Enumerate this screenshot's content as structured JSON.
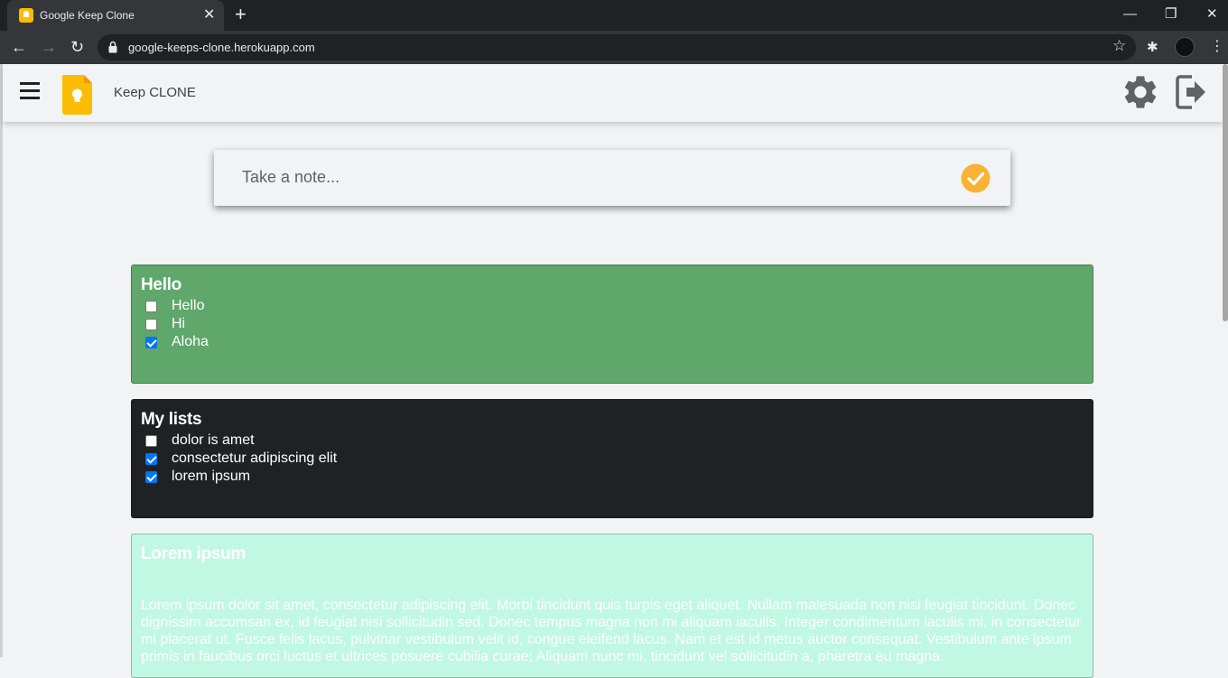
{
  "browser": {
    "tab_title": "Google Keep Clone",
    "tab_close": "✕",
    "new_tab": "+",
    "url": "google-keeps-clone.herokuapp.com",
    "minimize": "—",
    "maximize": "❐",
    "close": "✕",
    "back": "←",
    "forward": "→",
    "reload": "↻",
    "star": "☆",
    "extensions": "✱",
    "menu": "⋮"
  },
  "app": {
    "title": "Keep CLONE",
    "note_placeholder": "Take a note...",
    "colors": {
      "logo": "#fbbc04",
      "check": "#f9b233",
      "icon": "#5f6368"
    }
  },
  "notes": [
    {
      "title": "Hello",
      "bg": "#60a76c",
      "color": "#ffffff",
      "items": [
        {
          "text": "Hello",
          "checked": false
        },
        {
          "text": "Hi",
          "checked": false
        },
        {
          "text": "Aloha",
          "checked": true
        }
      ]
    },
    {
      "title": "My lists",
      "bg": "#202124",
      "color": "#ffffff",
      "items": [
        {
          "text": "dolor is amet",
          "checked": false
        },
        {
          "text": "consectetur adipiscing elit",
          "checked": true
        },
        {
          "text": "lorem ipsum",
          "checked": true
        }
      ]
    },
    {
      "title": "Lorem ipsum",
      "bg": "#c0f8e3",
      "color": "#ffffff",
      "body": "Lorem ipsum dolor sit amet, consectetur adipiscing elit. Morbi tincidunt quis turpis eget aliquet. Nullam malesuada non nisi feugiat tincidunt. Donec dignissim accumsan ex, id feugiat nisi sollicitudin sed. Donec tempus magna non mi aliquam iaculis. Integer condimentum iaculis mi, in consectetur mi placerat ut. Fusce felis lacus, pulvinar vestibulum velit id, congue eleifend lacus. Nam et est id metus auctor consequat. Vestibulum ante ipsum primis in faucibus orci luctus et ultrices posuere cubilia curae; Aliquam nunc mi, tincidunt vel sollicitudin a, pharetra eu magna."
    }
  ]
}
